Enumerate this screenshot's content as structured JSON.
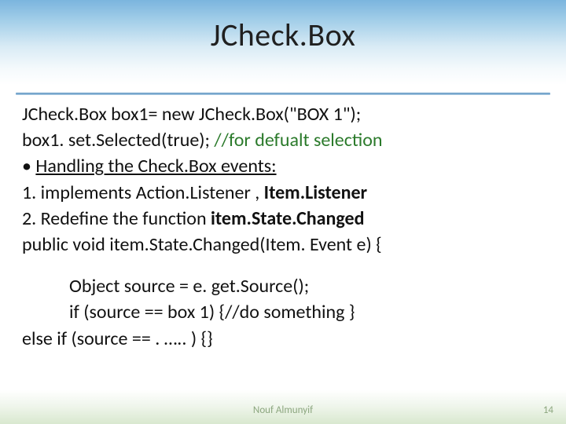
{
  "title": "JCheck.Box",
  "body": {
    "l1a": "JCheck.Box box1= new JCheck.Box(\"BOX 1\");",
    "l2a": "box1. set.Selected(true); ",
    "l2b": "//for defualt selection",
    "bullet": "• ",
    "l3_label": "Handling the Check.Box events:",
    "l4a": "1.   implements Action.Listener , ",
    "l4b": "Item.Listener",
    "l5a": "2.   Redefine the function ",
    "l5b": "item.State.Changed",
    "l6": "public void item.State.Changed(Item. Event e) {",
    "l7": "Object source = e. get.Source();",
    "l8": "if (source == box 1) {//do something  }",
    "l9": " else if (source == . ….. ) {}"
  },
  "footer": {
    "author": "Nouf Almunyif",
    "page": "14"
  }
}
